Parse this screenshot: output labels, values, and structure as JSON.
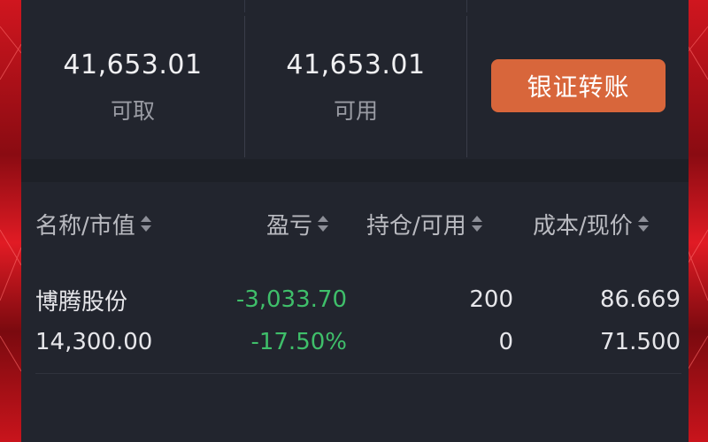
{
  "funds": {
    "withdrawable": {
      "value": "41,653.01",
      "label": "可取"
    },
    "available": {
      "value": "41,653.01",
      "label": "可用"
    },
    "transfer_button": "银证转账"
  },
  "table": {
    "headers": {
      "name_mv": "名称/市值",
      "pnl": "盈亏",
      "position": "持仓/可用",
      "cost_price": "成本/现价"
    },
    "rows": [
      {
        "name": "博腾股份",
        "market_value": "14,300.00",
        "pnl": "-3,033.70",
        "pnl_pct": "-17.50%",
        "position": "200",
        "available": "0",
        "cost": "86.669",
        "price": "71.500"
      }
    ]
  },
  "colors": {
    "accent": "#d8663b",
    "loss": "#3fbf6a",
    "panel": "#22252e",
    "frame": "#c9141c"
  }
}
